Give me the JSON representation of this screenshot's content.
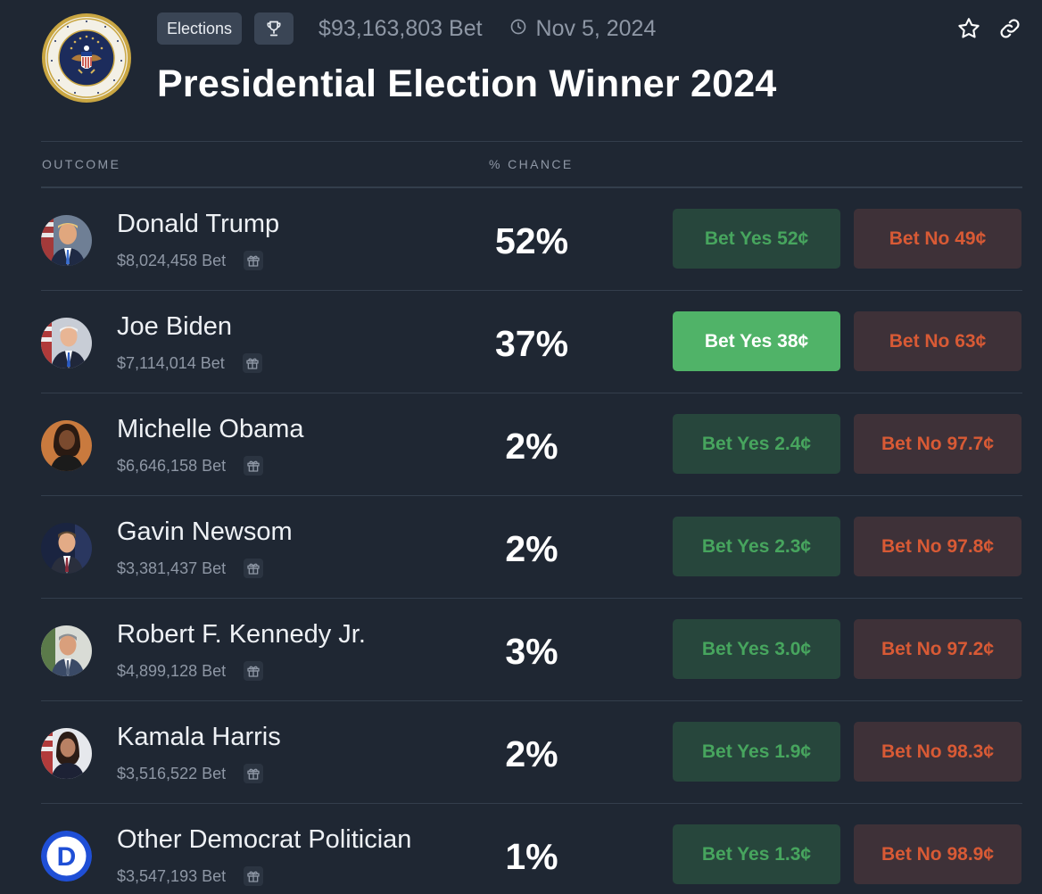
{
  "header": {
    "category_tag": "Elections",
    "trophy_icon": "trophy-icon",
    "volume": "$93,163,803 Bet",
    "clock_icon": "clock-icon",
    "date": "Nov 5, 2024",
    "title": "Presidential Election Winner 2024",
    "seal_icon": "presidential-seal-icon",
    "actions": {
      "favorite_icon": "star-icon",
      "share_icon": "link-icon"
    }
  },
  "table": {
    "columns": {
      "outcome": "OUTCOME",
      "chance": "% CHANCE"
    },
    "rows": [
      {
        "name": "Donald Trump",
        "volume": "$8,024,458 Bet",
        "chance": "52%",
        "yes": "Bet Yes 52¢",
        "no": "Bet No 49¢",
        "selected": false
      },
      {
        "name": "Joe Biden",
        "volume": "$7,114,014 Bet",
        "chance": "37%",
        "yes": "Bet Yes 38¢",
        "no": "Bet No 63¢",
        "selected": true
      },
      {
        "name": "Michelle Obama",
        "volume": "$6,646,158 Bet",
        "chance": "2%",
        "yes": "Bet Yes 2.4¢",
        "no": "Bet No 97.7¢",
        "selected": false
      },
      {
        "name": "Gavin Newsom",
        "volume": "$3,381,437 Bet",
        "chance": "2%",
        "yes": "Bet Yes 2.3¢",
        "no": "Bet No 97.8¢",
        "selected": false
      },
      {
        "name": "Robert F. Kennedy Jr.",
        "volume": "$4,899,128 Bet",
        "chance": "3%",
        "yes": "Bet Yes 3.0¢",
        "no": "Bet No 97.2¢",
        "selected": false
      },
      {
        "name": "Kamala Harris",
        "volume": "$3,516,522 Bet",
        "chance": "2%",
        "yes": "Bet Yes 1.9¢",
        "no": "Bet No 98.3¢",
        "selected": false
      },
      {
        "name": "Other Democrat Politician",
        "volume": "$3,547,193 Bet",
        "chance": "1%",
        "yes": "Bet Yes 1.3¢",
        "no": "Bet No 98.9¢",
        "selected": false,
        "avatar_letter": "D"
      }
    ]
  },
  "colors": {
    "background": "#1f2733",
    "yes_bg": "#27463c",
    "yes_text": "#47a55e",
    "yes_active_bg": "#50b368",
    "no_bg": "#3e3138",
    "no_text": "#d85a35",
    "democrat_blue": "#1f4fd6"
  }
}
